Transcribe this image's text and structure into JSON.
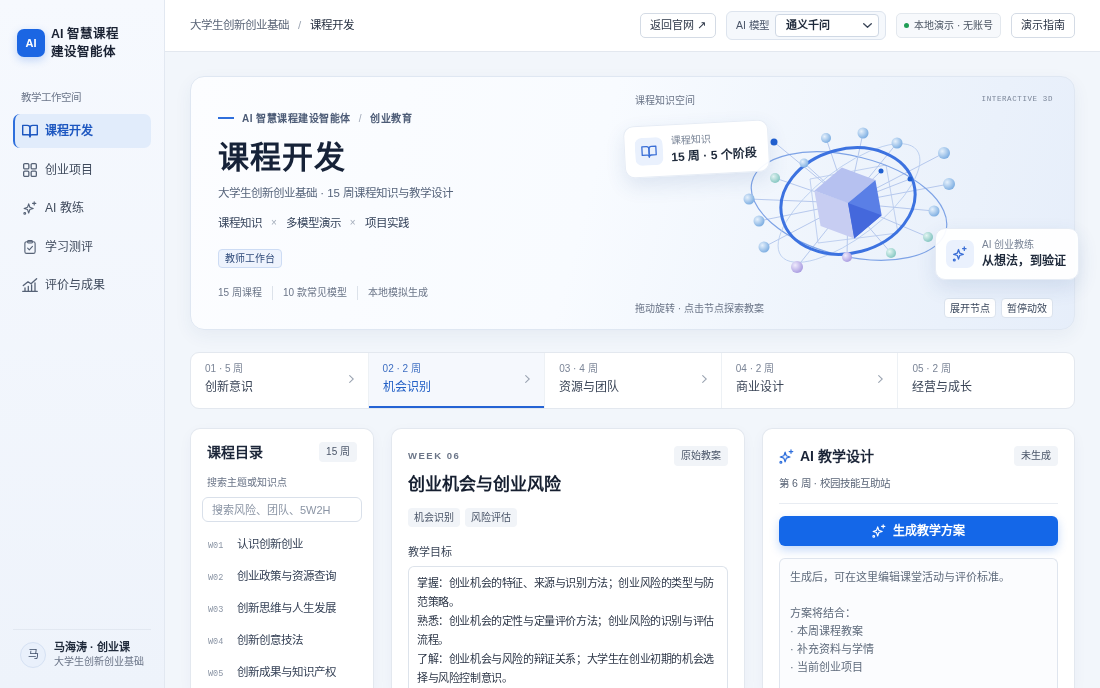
{
  "sidebar": {
    "logo": "AI",
    "title": "AI 智慧课程建设智能体",
    "section_label": "教学工作空间",
    "nav": [
      {
        "label": "课程开发",
        "selected": true
      },
      {
        "label": "创业项目",
        "selected": false
      },
      {
        "label": "AI 教练",
        "selected": false
      },
      {
        "label": "学习测评",
        "selected": false
      },
      {
        "label": "评价与成果",
        "selected": false
      }
    ],
    "user": {
      "avatar": "马",
      "name": "马海涛 · 创业课",
      "course": "大学生创新创业基础"
    }
  },
  "top_bar": {
    "breadcrumb": [
      {
        "label": "大学生创新创业基础"
      },
      {
        "label": "课程开发"
      }
    ],
    "breadcrumb_separator": "/",
    "back_button": "返回官网 ↗",
    "model_picker": {
      "label": "AI 模型",
      "value": "通义千问"
    },
    "status": "本地演示 · 无账号",
    "guide_button": "演示指南"
  },
  "hero": {
    "eyebrow": {
      "brand": "AI 智慧课程建设智能体",
      "separator": "/",
      "section": "创业教育"
    },
    "title": "课程开发",
    "subtitle": "大学生创新创业基础 · 15 周课程知识与教学设计",
    "pillars": [
      {
        "label": "课程知识"
      },
      {
        "separator": "×",
        "label": "多模型演示"
      },
      {
        "separator": "×",
        "label": "项目实践"
      }
    ],
    "tag": "教师工作台",
    "stats": [
      "15 周课程",
      "10 款常见模型",
      "本地模拟生成"
    ],
    "scene": {
      "label": "课程知识空间",
      "badge": "INTERACTIVE 3D",
      "cards": [
        {
          "title": "课程知识",
          "value": "15 周 · 5 个阶段"
        },
        {
          "title": "AI 创业教练",
          "value": "从想法，到验证"
        }
      ],
      "hint": "拖动旋转 · 点击节点探索教案",
      "buttons": [
        "展开节点",
        "暂停动效"
      ]
    }
  },
  "phases": [
    {
      "meta": "01 · 5 周",
      "name": "创新意识",
      "selected": false
    },
    {
      "meta": "02 · 2 周",
      "name": "机会识别",
      "selected": true
    },
    {
      "meta": "03 · 4 周",
      "name": "资源与团队",
      "selected": false
    },
    {
      "meta": "04 · 2 周",
      "name": "商业设计",
      "selected": false
    },
    {
      "meta": "05 · 2 周",
      "name": "经营与成长",
      "selected": false
    }
  ],
  "catalog": {
    "title": "课程目录",
    "count": "15 周",
    "search_label": "搜索主题或知识点",
    "placeholder": "搜索风险、团队、5W2H",
    "items": [
      {
        "code": "W01",
        "title": "认识创新创业",
        "selected": false
      },
      {
        "code": "W02",
        "title": "创业政策与资源查询",
        "selected": false
      },
      {
        "code": "W03",
        "title": "创新思维与人生发展",
        "selected": false
      },
      {
        "code": "W04",
        "title": "创新创意技法",
        "selected": false
      },
      {
        "code": "W05",
        "title": "创新成果与知识产权",
        "selected": false
      }
    ]
  },
  "lesson": {
    "week": "WEEK 06",
    "source": "原始教案",
    "title": "创业机会与创业风险",
    "tags": [
      "机会识别",
      "风险评估"
    ],
    "objectives_label": "教学目标",
    "objectives": [
      "掌握：创业机会的特征、来源与识别方法；创业风险的类型与防范策略。",
      "熟悉：创业机会的定性与定量评价方法；创业风险的识别与评估流程。",
      "了解：创业机会与风险的辩证关系；大学生在创业初期的机会选择与风险控制意识。"
    ]
  },
  "ai_design": {
    "title": "AI 教学设计",
    "status": "未生成",
    "subtitle": "第 6 周 · 校园技能互助站",
    "button": "生成教学方案",
    "placeholder": {
      "text": "生成后，可在这里编辑课堂活动与评价标准。",
      "list_title": "方案将结合：",
      "list": [
        "· 本周课程教案",
        "· 补充资料与学情",
        "· 当前创业项目"
      ]
    }
  }
}
